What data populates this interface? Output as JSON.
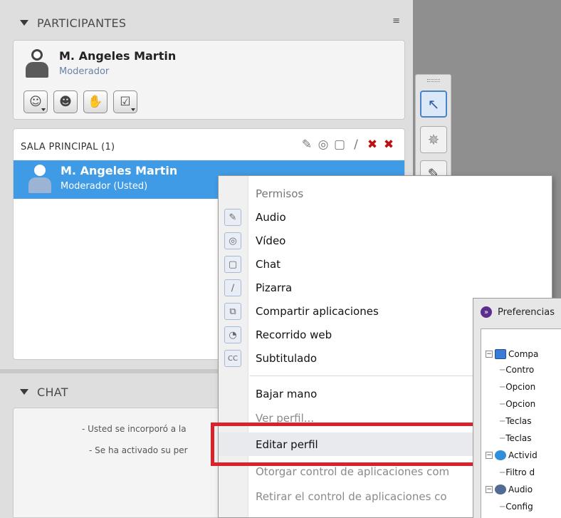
{
  "participants": {
    "header_title": "PARTICIPANTES",
    "menu_icon": "≡",
    "me": {
      "name": "M. Angeles Martin",
      "role": "Moderador"
    },
    "tool_buttons": [
      {
        "name": "emotion-icon",
        "glyph": "☺",
        "caret": true
      },
      {
        "name": "profile-icon",
        "glyph": "☻",
        "caret": false
      },
      {
        "name": "raise-hand-icon",
        "glyph": "✋",
        "caret": false
      },
      {
        "name": "checkbox-icon",
        "glyph": "☑",
        "caret": true
      }
    ]
  },
  "room": {
    "title": "SALA PRINCIPAL (1)",
    "permission_icons": [
      "✎",
      "◎",
      "▢",
      "∕",
      "✖",
      "✖"
    ],
    "selected": {
      "name": "M. Angeles Martin",
      "role": "Moderador (Usted)"
    }
  },
  "chat": {
    "header_title": "CHAT",
    "messages": [
      "- Usted se incorporó a la",
      "- Se ha activado su per"
    ]
  },
  "context_menu": {
    "section_title": "Permisos",
    "permissions": [
      {
        "label": "Audio",
        "icon": "✎"
      },
      {
        "label": "Vídeo",
        "icon": "◎"
      },
      {
        "label": "Chat",
        "icon": "▢"
      },
      {
        "label": "Pizarra",
        "icon": "∕"
      },
      {
        "label": "Compartir aplicaciones",
        "icon": "⧉"
      },
      {
        "label": "Recorrido web",
        "icon": "◔"
      },
      {
        "label": "Subtitulado",
        "icon": "CC"
      }
    ],
    "actions": {
      "lower_hand": "Bajar mano",
      "view_profile": "Ver perfil...",
      "edit_profile": "Editar perfil",
      "grant_control": "Otorgar control de aplicaciones com",
      "revoke_control": "Retirar el control de aplicaciones co"
    }
  },
  "preferences": {
    "title": "Preferencias",
    "tree": [
      {
        "label": "Compa",
        "level": 0,
        "expander": "−",
        "icon": "monitor"
      },
      {
        "label": "Contro",
        "level": 1
      },
      {
        "label": "Opcion",
        "level": 1
      },
      {
        "label": "Opcion",
        "level": 1
      },
      {
        "label": "Teclas",
        "level": 1
      },
      {
        "label": "Teclas",
        "level": 1
      },
      {
        "label": "Activid",
        "level": 0,
        "expander": "−",
        "icon": "activ"
      },
      {
        "label": "Filtro d",
        "level": 1
      },
      {
        "label": "Audio",
        "level": 0,
        "expander": "−",
        "icon": "audio"
      },
      {
        "label": "Config",
        "level": 1
      }
    ]
  },
  "colors": {
    "selected_row": "#3f9be6",
    "highlight_box": "#d8232a",
    "role_text": "#6a83a8"
  }
}
